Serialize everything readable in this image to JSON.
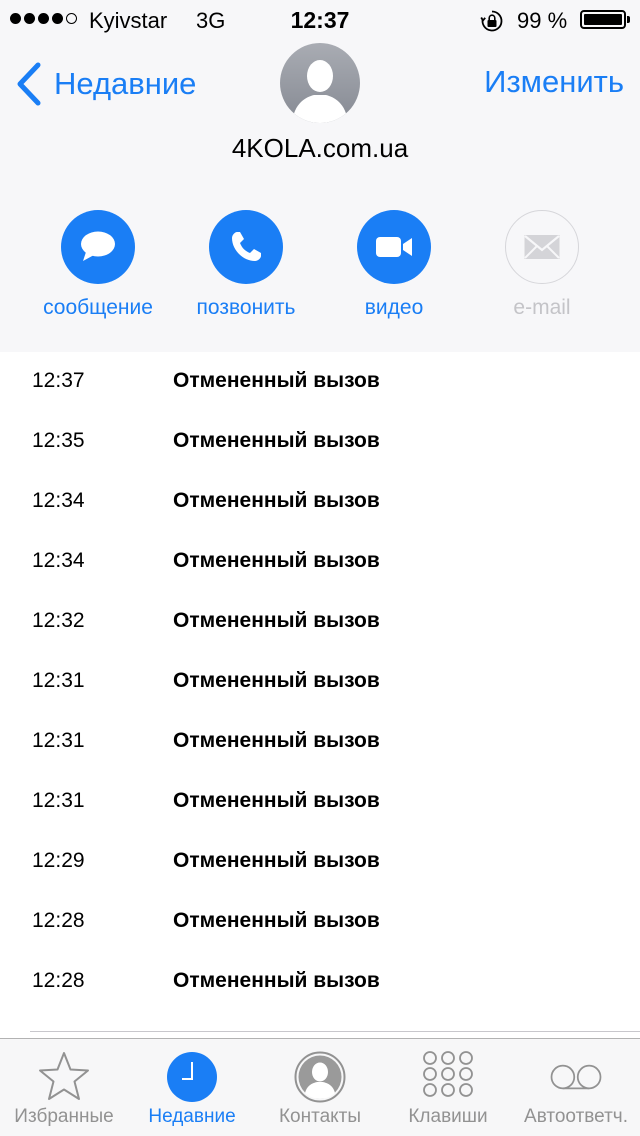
{
  "status_bar": {
    "carrier": "Kyivstar",
    "network": "3G",
    "time": "12:37",
    "battery": "99 %",
    "battery_level": 0.99
  },
  "nav": {
    "back_label": "Недавние",
    "edit_label": "Изменить"
  },
  "contact": {
    "name": "4KOLA.com.ua"
  },
  "actions": [
    {
      "label": "сообщение",
      "icon": "message-icon",
      "enabled": true
    },
    {
      "label": "позвонить",
      "icon": "phone-icon",
      "enabled": true
    },
    {
      "label": "видео",
      "icon": "video-icon",
      "enabled": true
    },
    {
      "label": "e-mail",
      "icon": "mail-icon",
      "enabled": false
    }
  ],
  "calls": [
    {
      "time": "12:37",
      "type": "Отмененный вызов"
    },
    {
      "time": "12:35",
      "type": "Отмененный вызов"
    },
    {
      "time": "12:34",
      "type": "Отмененный вызов"
    },
    {
      "time": "12:34",
      "type": "Отмененный вызов"
    },
    {
      "time": "12:32",
      "type": "Отмененный вызов"
    },
    {
      "time": "12:31",
      "type": "Отмененный вызов"
    },
    {
      "time": "12:31",
      "type": "Отмененный вызов"
    },
    {
      "time": "12:31",
      "type": "Отмененный вызов"
    },
    {
      "time": "12:29",
      "type": "Отмененный вызов"
    },
    {
      "time": "12:28",
      "type": "Отмененный вызов"
    },
    {
      "time": "12:28",
      "type": "Отмененный вызов"
    }
  ],
  "tabs": [
    {
      "label": "Избранные",
      "icon": "star-icon",
      "active": false
    },
    {
      "label": "Недавние",
      "icon": "clock-icon",
      "active": true
    },
    {
      "label": "Контакты",
      "icon": "contact-icon",
      "active": false
    },
    {
      "label": "Клавиши",
      "icon": "keypad-icon",
      "active": false
    },
    {
      "label": "Автоответч.",
      "icon": "voicemail-icon",
      "active": false
    }
  ],
  "colors": {
    "accent": "#1a7ef5",
    "inactive": "#929292",
    "disabled": "#c4c4c8"
  }
}
